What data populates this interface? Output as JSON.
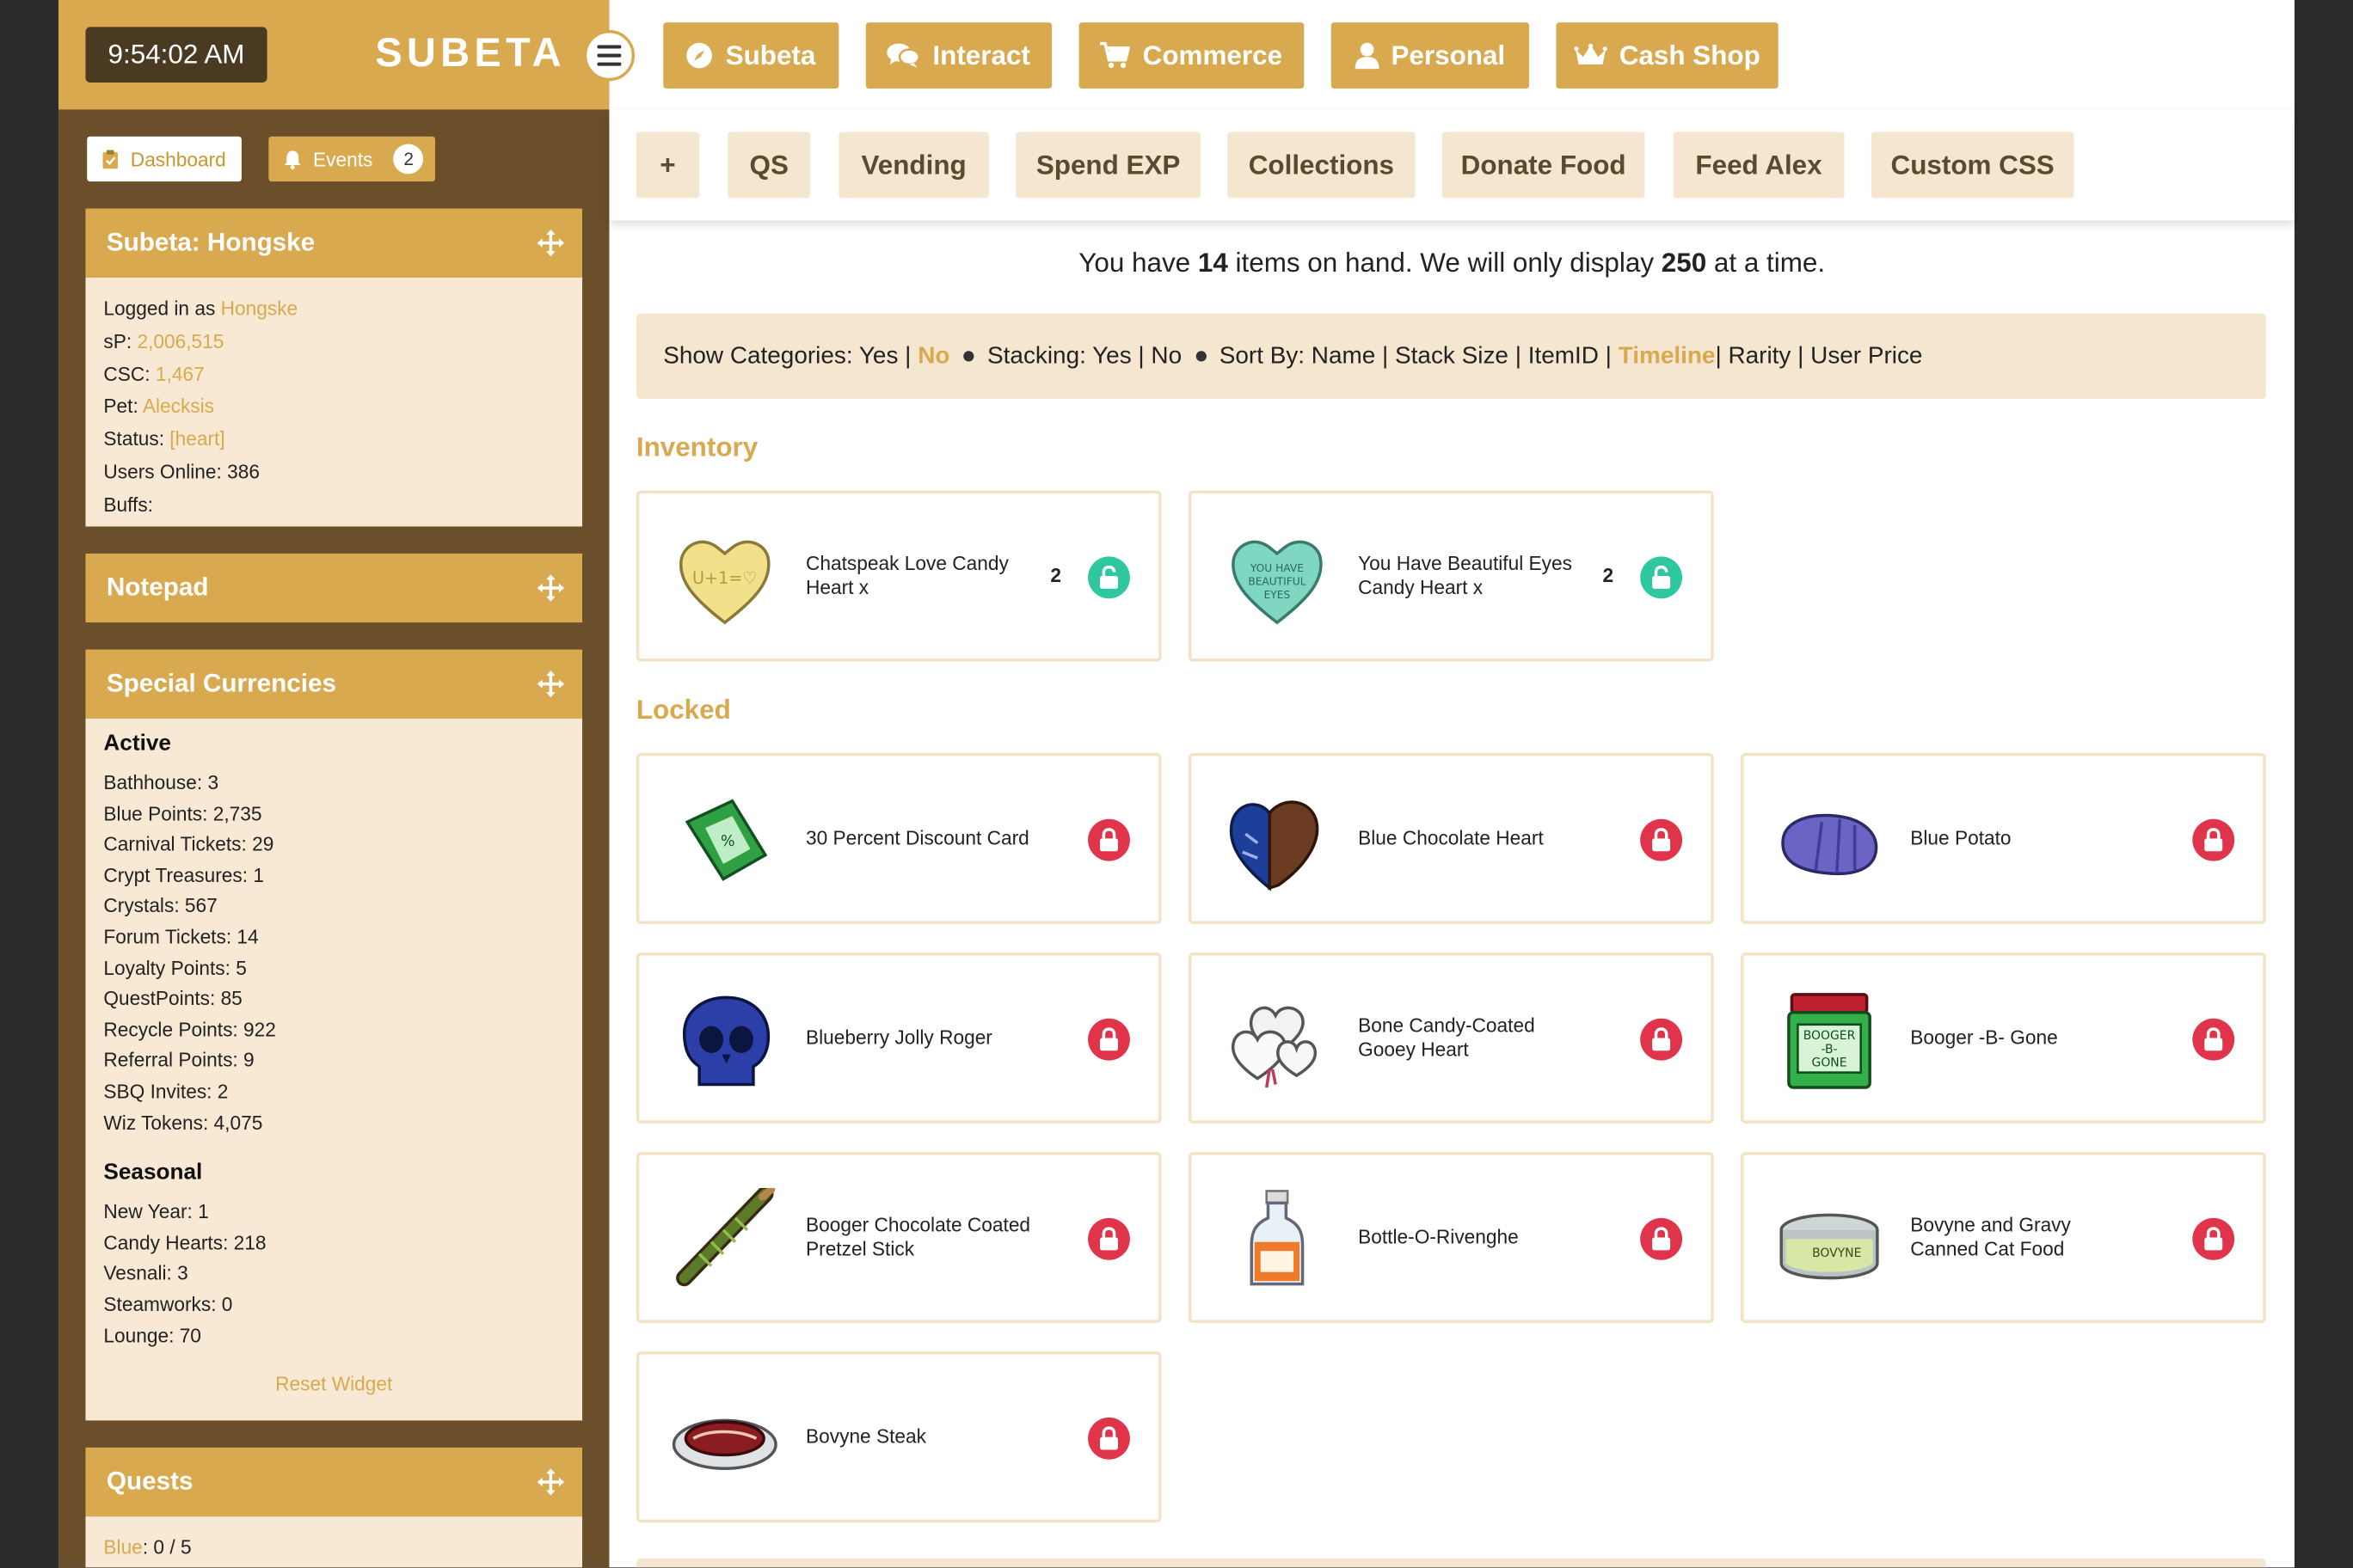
{
  "header": {
    "clock": "9:54:02 AM",
    "brand": "SUBETA"
  },
  "sidebar": {
    "dashboard_label": "Dashboard",
    "events_label": "Events",
    "events_count": "2",
    "profile": {
      "title": "Subeta: Hongske",
      "logged_in_label": "Logged in as ",
      "username": "Hongske",
      "sp_label": "sP: ",
      "sp_value": "2,006,515",
      "csc_label": "CSC: ",
      "csc_value": "1,467",
      "pet_label": "Pet: ",
      "pet_value": "Alecksis",
      "status_label": "Status: ",
      "status_value": "[heart]",
      "users_online": "Users Online: 386",
      "buffs": "Buffs:"
    },
    "notepad_title": "Notepad",
    "currencies": {
      "title": "Special Currencies",
      "active_heading": "Active",
      "active": [
        "Bathhouse: 3",
        "Blue Points: 2,735",
        "Carnival Tickets: 29",
        "Crypt Treasures: 1",
        "Crystals: 567",
        "Forum Tickets: 14",
        "Loyalty Points: 5",
        "QuestPoints: 85",
        "Recycle Points: 922",
        "Referral Points: 9",
        "SBQ Invites: 2",
        "Wiz Tokens: 4,075"
      ],
      "seasonal_heading": "Seasonal",
      "seasonal": [
        "New Year: 1",
        "Candy Hearts: 218",
        "Vesnali: 3",
        "Steamworks: 0",
        "Lounge: 70"
      ],
      "reset_label": "Reset Widget"
    },
    "quests": {
      "title": "Quests",
      "blue_label": "Blue",
      "blue_value": ": 0 / 5"
    }
  },
  "topnav": {
    "items": [
      "Subeta",
      "Interact",
      "Commerce",
      "Personal",
      "Cash Shop"
    ]
  },
  "subnav": {
    "items": [
      "+",
      "QS",
      "Vending",
      "Spend EXP",
      "Collections",
      "Donate Food",
      "Feed Alex",
      "Custom CSS"
    ]
  },
  "main": {
    "onhand_prefix": "You have ",
    "onhand_count": "14",
    "onhand_middle": " items on hand. We will only display ",
    "onhand_limit": "250",
    "onhand_suffix": " at a time.",
    "controls": {
      "show_categories_label": "Show Categories: Yes | ",
      "show_categories_selected": "No",
      "stacking_label": "Stacking: Yes | No",
      "sort_label": "Sort By: Name | Stack Size | ItemID | ",
      "sort_selected": "Timeline",
      "sort_rest": " | Rarity | User Price"
    },
    "inventory_title": "Inventory",
    "locked_title": "Locked",
    "inventory_items": [
      {
        "name": "Chatspeak Love Candy Heart x",
        "qty": "2",
        "icon": "yellow-candy-heart-icon"
      },
      {
        "name": "You Have Beautiful Eyes Candy Heart x",
        "qty": "2",
        "icon": "teal-candy-heart-icon"
      }
    ],
    "locked_items": [
      {
        "name": "30 Percent Discount Card",
        "icon": "discount-card-icon"
      },
      {
        "name": "Blue Chocolate Heart",
        "icon": "chocolate-heart-icon"
      },
      {
        "name": "Blue Potato",
        "icon": "blue-potato-icon"
      },
      {
        "name": "Blueberry Jolly Roger",
        "icon": "skull-candy-icon"
      },
      {
        "name": "Bone Candy-Coated Gooey Heart",
        "icon": "bone-heart-icon"
      },
      {
        "name": "Booger -B- Gone",
        "icon": "jar-icon"
      },
      {
        "name": "Booger Chocolate Coated Pretzel Stick",
        "icon": "pretzel-stick-icon"
      },
      {
        "name": "Bottle-O-Rivenghe",
        "icon": "bottle-icon"
      },
      {
        "name": "Bovyne and Gravy Canned Cat Food",
        "icon": "cat-food-can-icon"
      },
      {
        "name": "Bovyne Steak",
        "icon": "steak-icon"
      }
    ]
  },
  "colors": {
    "accent": "#d9a94f",
    "sidebar_bg": "#6b4f2a",
    "panel_bg": "#f7e9d3",
    "unlock_green": "#2ec7a0",
    "lock_red": "#e0344a"
  }
}
